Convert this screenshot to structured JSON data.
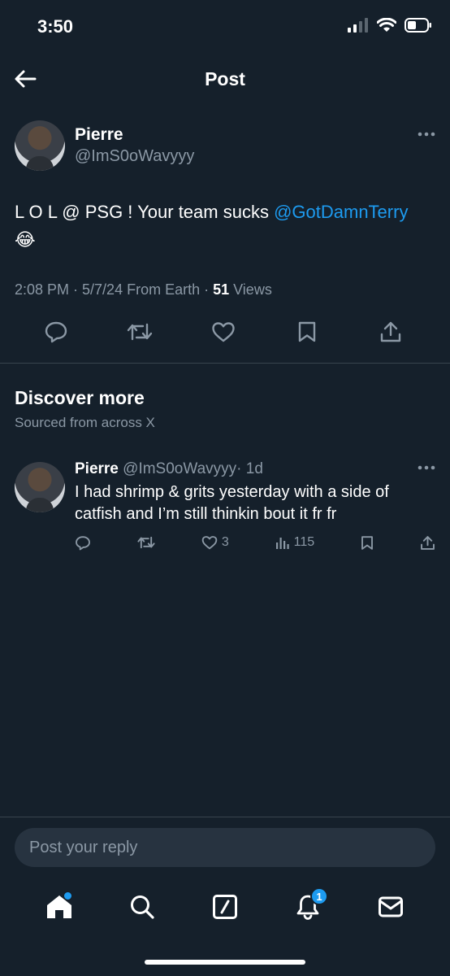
{
  "status_bar": {
    "time": "3:50"
  },
  "header": {
    "title": "Post"
  },
  "post": {
    "author_name": "Pierre",
    "author_handle": "@ImS0oWavyyy",
    "text_main": "L O L @ PSG ! Your team sucks ",
    "mention": "@GotDamnTerry",
    "emoji": "😂",
    "time": "2:08 PM · 5/7/24 From Earth · ",
    "views_count": "51",
    "views_label": " Views"
  },
  "discover": {
    "title": "Discover more",
    "subtitle": "Sourced from across X"
  },
  "discover_post": {
    "author_name": "Pierre",
    "author_handle": "@ImS0oWavyyy",
    "age": "· 1d",
    "text": "I had shrimp & grits yesterday with a side of catfish and I’m still thinkin bout it fr fr",
    "likes": "3",
    "views": "115"
  },
  "reply": {
    "placeholder": "Post your reply"
  },
  "tab_bar": {
    "notifications_badge": "1"
  },
  "colors": {
    "background": "#15202b",
    "accent": "#1d9bf0",
    "muted": "#8b98a5",
    "divider": "#38444d"
  },
  "icons": [
    "back-arrow-icon",
    "more-icon",
    "reply-icon",
    "retweet-icon",
    "like-icon",
    "bookmark-icon",
    "share-icon",
    "views-icon",
    "home-icon",
    "search-icon",
    "compose-icon",
    "notifications-icon",
    "messages-icon"
  ]
}
